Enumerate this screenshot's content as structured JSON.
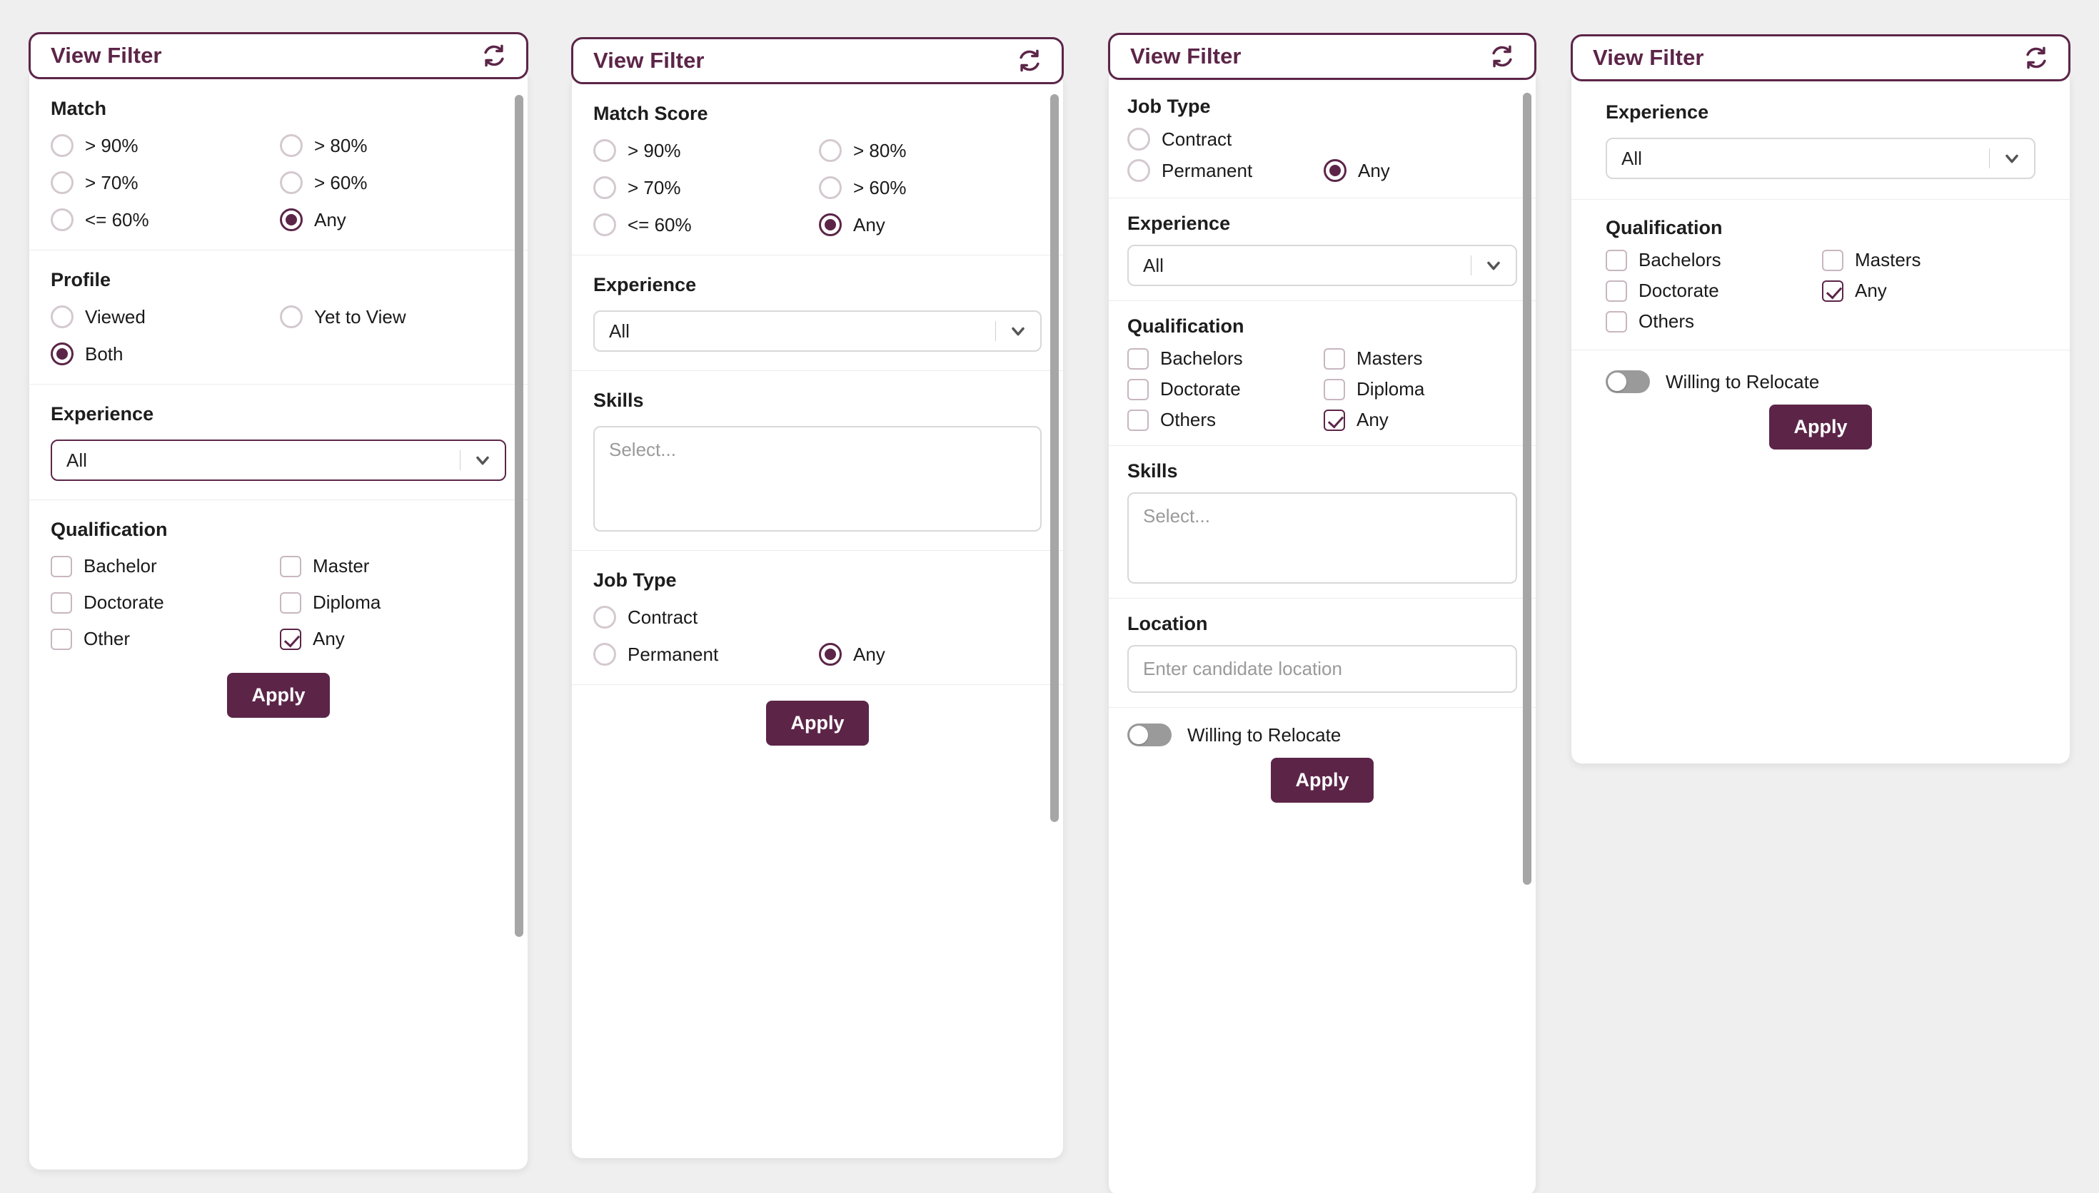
{
  "header": {
    "title": "View Filter",
    "refresh_icon": "refresh-icon"
  },
  "panels": [
    {
      "id": "panel-1",
      "title": "View Filter",
      "sections": {
        "match": {
          "title": "Match",
          "options": [
            {
              "label": "> 90%",
              "selected": false
            },
            {
              "label": "> 80%",
              "selected": false
            },
            {
              "label": "> 70%",
              "selected": false
            },
            {
              "label": "> 60%",
              "selected": false
            },
            {
              "label": "<= 60%",
              "selected": false
            },
            {
              "label": "Any",
              "selected": true
            }
          ]
        },
        "profile": {
          "title": "Profile",
          "options": [
            {
              "label": "Viewed",
              "selected": false
            },
            {
              "label": "Yet to View",
              "selected": false
            },
            {
              "label": "Both",
              "selected": true
            }
          ]
        },
        "experience": {
          "title": "Experience",
          "value": "All",
          "caret_icon": "chevron-down-icon"
        },
        "qualification": {
          "title": "Qualification",
          "options": [
            {
              "label": "Bachelor",
              "checked": false
            },
            {
              "label": "Master",
              "checked": false
            },
            {
              "label": "Doctorate",
              "checked": false
            },
            {
              "label": "Diploma",
              "checked": false
            },
            {
              "label": "Other",
              "checked": false
            },
            {
              "label": "Any",
              "checked": true
            }
          ]
        }
      },
      "apply_label": "Apply"
    },
    {
      "id": "panel-2",
      "title": "View Filter",
      "sections": {
        "match_score": {
          "title": "Match Score",
          "options": [
            {
              "label": "> 90%",
              "selected": false
            },
            {
              "label": "> 80%",
              "selected": false
            },
            {
              "label": "> 70%",
              "selected": false
            },
            {
              "label": "> 60%",
              "selected": false
            },
            {
              "label": "<= 60%",
              "selected": false
            },
            {
              "label": "Any",
              "selected": true
            }
          ]
        },
        "experience": {
          "title": "Experience",
          "value": "All",
          "caret_icon": "chevron-down-icon"
        },
        "skills": {
          "title": "Skills",
          "placeholder": "Select..."
        },
        "job_type": {
          "title": "Job Type",
          "options": [
            {
              "label": "Contract",
              "selected": false
            },
            {
              "label": "Permanent",
              "selected": false
            },
            {
              "label": "Any",
              "selected": true
            }
          ]
        }
      },
      "apply_label": "Apply"
    },
    {
      "id": "panel-3",
      "title": "View Filter",
      "sections": {
        "job_type": {
          "title": "Job Type",
          "options": [
            {
              "label": "Contract",
              "selected": false
            },
            {
              "label": "Permanent",
              "selected": false
            },
            {
              "label": "Any",
              "selected": true
            }
          ]
        },
        "experience": {
          "title": "Experience",
          "value": "All",
          "caret_icon": "chevron-down-icon"
        },
        "qualification": {
          "title": "Qualification",
          "options": [
            {
              "label": "Bachelors",
              "checked": false
            },
            {
              "label": "Masters",
              "checked": false
            },
            {
              "label": "Doctorate",
              "checked": false
            },
            {
              "label": "Diploma",
              "checked": false
            },
            {
              "label": "Others",
              "checked": false
            },
            {
              "label": "Any",
              "checked": true
            }
          ]
        },
        "skills": {
          "title": "Skills",
          "placeholder": "Select..."
        },
        "location": {
          "title": "Location",
          "placeholder": "Enter candidate location"
        },
        "relocate": {
          "label": "Willing to Relocate",
          "on": false
        }
      },
      "apply_label": "Apply"
    },
    {
      "id": "panel-4",
      "title": "View Filter",
      "sections": {
        "experience": {
          "title": "Experience",
          "value": "All",
          "caret_icon": "chevron-down-icon"
        },
        "qualification": {
          "title": "Qualification",
          "options": [
            {
              "label": "Bachelors",
              "checked": false
            },
            {
              "label": "Masters",
              "checked": false
            },
            {
              "label": "Doctorate",
              "checked": false
            },
            {
              "label": "Any",
              "checked": true
            },
            {
              "label": "Others",
              "checked": false
            }
          ]
        },
        "relocate": {
          "label": "Willing to Relocate",
          "on": false
        }
      },
      "apply_label": "Apply"
    }
  ],
  "colors": {
    "brand": "#5C2548",
    "page_bg": "#efefef",
    "panel_bg": "#ffffff",
    "muted_text": "#9a9a9a",
    "toggle_off": "#9a9a9a"
  }
}
